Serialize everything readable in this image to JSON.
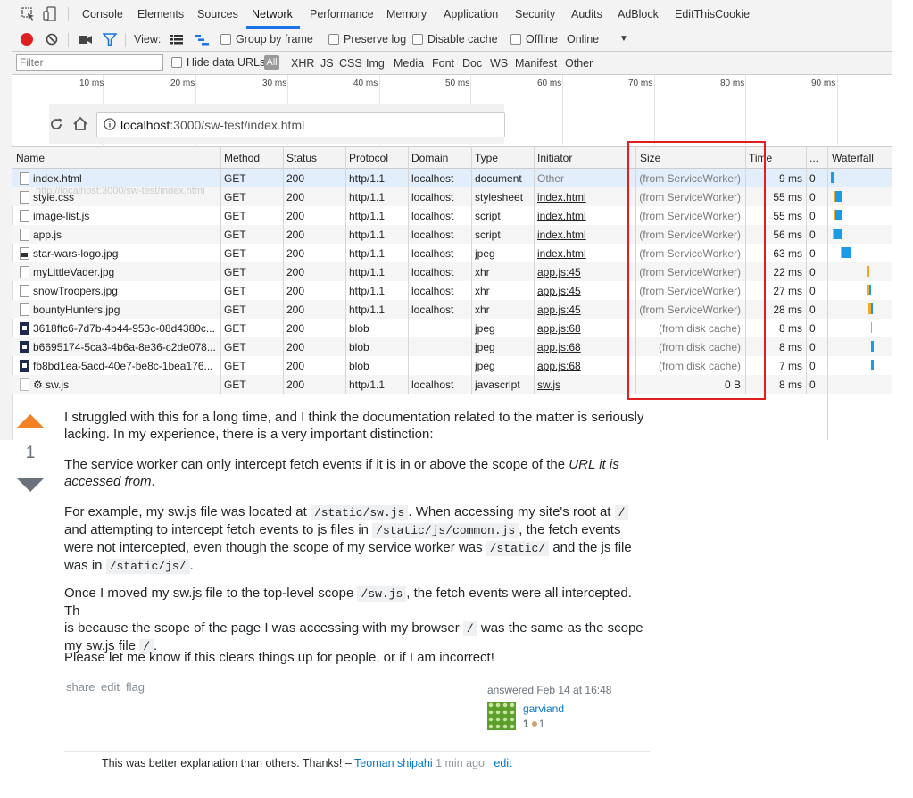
{
  "devtools": {
    "tabs": [
      "Console",
      "Elements",
      "Sources",
      "Network",
      "Performance",
      "Memory",
      "Application",
      "Security",
      "Audits",
      "AdBlock",
      "EditThisCookie"
    ],
    "active_tab": "Network",
    "toolbar": {
      "view_label": "View:",
      "group_by_frame": "Group by frame",
      "preserve_log": "Preserve log",
      "disable_cache": "Disable cache",
      "offline": "Offline",
      "throttle": "Online"
    },
    "filter": {
      "placeholder": "Filter",
      "hide_data_urls": "Hide data URLs",
      "types": [
        "All",
        "XHR",
        "JS",
        "CSS",
        "Img",
        "Media",
        "Font",
        "Doc",
        "WS",
        "Manifest",
        "Other"
      ]
    },
    "timeline_ticks": [
      "10 ms",
      "20 ms",
      "30 ms",
      "40 ms",
      "50 ms",
      "60 ms",
      "70 ms",
      "80 ms",
      "90 ms"
    ],
    "browser": {
      "url_host": "localhost",
      "url_rest": ":3000/sw-test/index.html"
    },
    "tooltip": "http://localhost:3000/sw-test/index.html",
    "columns": [
      "Name",
      "Method",
      "Status",
      "Protocol",
      "Domain",
      "Type",
      "Initiator",
      "Size",
      "Time",
      "...",
      "Waterfall"
    ],
    "rows": [
      {
        "name": "index.html",
        "method": "GET",
        "status": "200",
        "protocol": "http/1.1",
        "domain": "localhost",
        "type": "document",
        "initiator": "Other",
        "size": "(from ServiceWorker)",
        "time": "9 ms",
        "extra": "0",
        "icon": "doc"
      },
      {
        "name": "style.css",
        "method": "GET",
        "status": "200",
        "protocol": "http/1.1",
        "domain": "localhost",
        "type": "stylesheet",
        "initiator": "index.html",
        "size": "(from ServiceWorker)",
        "time": "55 ms",
        "extra": "0",
        "icon": "doc"
      },
      {
        "name": "image-list.js",
        "method": "GET",
        "status": "200",
        "protocol": "http/1.1",
        "domain": "localhost",
        "type": "script",
        "initiator": "index.html",
        "size": "(from ServiceWorker)",
        "time": "55 ms",
        "extra": "0",
        "icon": "doc"
      },
      {
        "name": "app.js",
        "method": "GET",
        "status": "200",
        "protocol": "http/1.1",
        "domain": "localhost",
        "type": "script",
        "initiator": "index.html",
        "size": "(from ServiceWorker)",
        "time": "56 ms",
        "extra": "0",
        "icon": "doc"
      },
      {
        "name": "star-wars-logo.jpg",
        "method": "GET",
        "status": "200",
        "protocol": "http/1.1",
        "domain": "localhost",
        "type": "jpeg",
        "initiator": "index.html",
        "size": "(from ServiceWorker)",
        "time": "63 ms",
        "extra": "0",
        "icon": "img"
      },
      {
        "name": "myLittleVader.jpg",
        "method": "GET",
        "status": "200",
        "protocol": "http/1.1",
        "domain": "localhost",
        "type": "xhr",
        "initiator": "app.js:45",
        "size": "(from ServiceWorker)",
        "time": "22 ms",
        "extra": "0",
        "icon": "doc"
      },
      {
        "name": "snowTroopers.jpg",
        "method": "GET",
        "status": "200",
        "protocol": "http/1.1",
        "domain": "localhost",
        "type": "xhr",
        "initiator": "app.js:45",
        "size": "(from ServiceWorker)",
        "time": "27 ms",
        "extra": "0",
        "icon": "doc"
      },
      {
        "name": "bountyHunters.jpg",
        "method": "GET",
        "status": "200",
        "protocol": "http/1.1",
        "domain": "localhost",
        "type": "xhr",
        "initiator": "app.js:45",
        "size": "(from ServiceWorker)",
        "time": "28 ms",
        "extra": "0",
        "icon": "doc"
      },
      {
        "name": "3618ffc6-7d7b-4b44-953c-08d4380c...",
        "method": "GET",
        "status": "200",
        "protocol": "blob",
        "domain": "",
        "type": "jpeg",
        "initiator": "app.js:68",
        "size": "(from disk cache)",
        "time": "8 ms",
        "extra": "0",
        "icon": "blob"
      },
      {
        "name": "b6695174-5ca3-4b6a-8e36-c2de078...",
        "method": "GET",
        "status": "200",
        "protocol": "blob",
        "domain": "",
        "type": "jpeg",
        "initiator": "app.js:68",
        "size": "(from disk cache)",
        "time": "8 ms",
        "extra": "0",
        "icon": "blob"
      },
      {
        "name": "fb8bd1ea-5acd-40e7-be8c-1bea176...",
        "method": "GET",
        "status": "200",
        "protocol": "blob",
        "domain": "",
        "type": "jpeg",
        "initiator": "app.js:68",
        "size": "(from disk cache)",
        "time": "7 ms",
        "extra": "0",
        "icon": "blob"
      },
      {
        "name": "⚙ sw.js",
        "method": "GET",
        "status": "200",
        "protocol": "http/1.1",
        "domain": "localhost",
        "type": "javascript",
        "initiator": "sw.js",
        "size": "0 B",
        "time": "8 ms",
        "extra": "0",
        "icon": "sw"
      }
    ]
  },
  "answer": {
    "votes": "1",
    "p1": "I struggled with this for a long time, and I think the documentation related to the matter is seriously lacking. In my experience, there is a very important distinction:",
    "p2_a": "The service worker can only intercept fetch events if it is in or above the scope of the ",
    "p2_em": "URL it is accessed from",
    "p2_b": ".",
    "p3_a": "For example, my sw.js file was located at ",
    "p3_c1": "/static/sw.js",
    "p3_b": ". When accessing my site's root at ",
    "p3_c2": "/",
    "p3_c": " and attempting to intercept fetch events to js files in ",
    "p3_c3": "/static/js/common.js",
    "p3_d": ", the fetch events were not intercepted, even though the scope of my service worker was ",
    "p3_c4": "/static/",
    "p3_e": " and the js file was in ",
    "p3_c5": "/static/js/",
    "p3_f": ".",
    "p4_a": "Once I moved my sw.js file to the top-level scope ",
    "p4_c1": "/sw.js",
    "p4_b": ", the fetch events were all intercepted. Th",
    "p4_c": "is because the scope of the page I was accessing with my browser ",
    "p4_c2": "/",
    "p4_d": " was the same as the scope",
    "p4_e": "my sw.js file ",
    "p4_c3": "/",
    "p4_f": ".",
    "p5": "Please let me know if this clears things up for people, or if I am incorrect!",
    "menu": [
      "share",
      "edit",
      "flag"
    ],
    "answered": "answered Feb 14 at 16:48",
    "user": "garviand",
    "rep": "1",
    "badges": "1",
    "comment": {
      "text": "This was better explanation than others. Thanks! – ",
      "user": "Teoman shipahi",
      "time": "1 min ago",
      "edit": "edit"
    }
  }
}
